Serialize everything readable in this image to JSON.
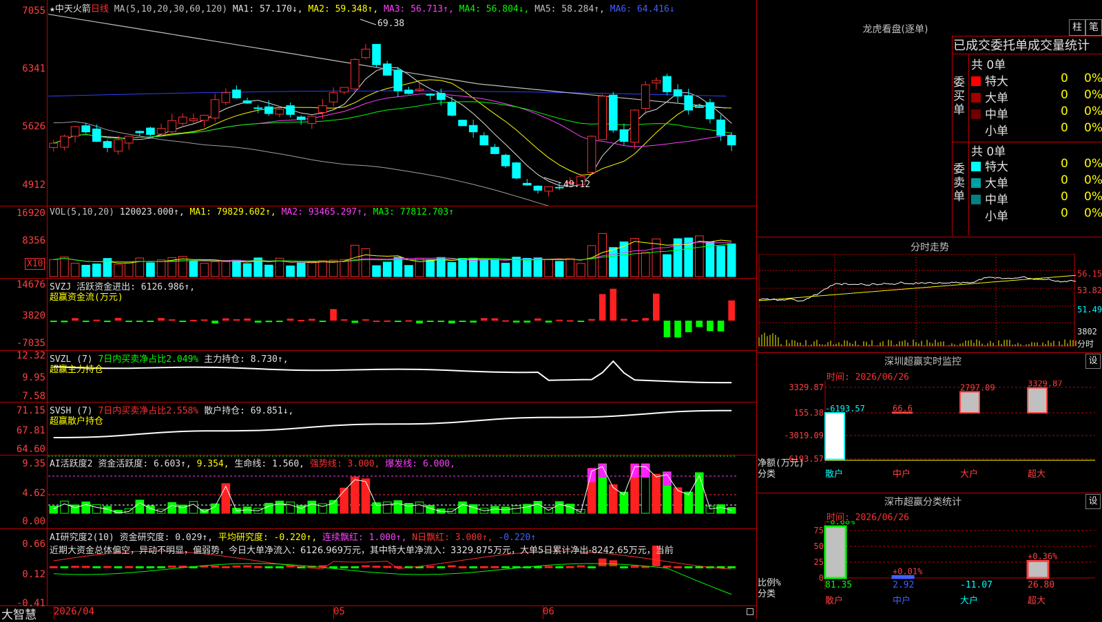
{
  "main": {
    "title": "中天火箭",
    "period": "日线",
    "ma_label": "MA(5,10,20,30,60,120)",
    "ma_values": [
      {
        "label": "MA1: 57.170↓,",
        "color": "#e0e0e0"
      },
      {
        "label": "MA2: 59.348↑,",
        "color": "#ffff00"
      },
      {
        "label": "MA3: 56.713↑,",
        "color": "#ff40ff"
      },
      {
        "label": "MA4: 56.804↓,",
        "color": "#00ff00"
      },
      {
        "label": "MA5: 58.284↑,",
        "color": "#c0c0c0"
      },
      {
        "label": "MA6: 64.416↓",
        "color": "#4060ff"
      }
    ],
    "y_ticks": [
      "7055",
      "6341",
      "5626",
      "4912"
    ],
    "high_label": "69.38",
    "low_label": "49.12"
  },
  "vol": {
    "label": "VOL(5,10,20)",
    "value": "120023.000↑,",
    "ma1": "MA1: 79829.602↑,",
    "ma2": "MA2: 93465.297↑,",
    "ma3": "MA3: 77812.703↑",
    "y_ticks": [
      "16920",
      "8356"
    ],
    "unit": "X10"
  },
  "svzj": {
    "label": "SVZJ  活跃资金进出: 6126.986↑,",
    "sub": "超赢资金流(万元)",
    "y_ticks": [
      "14676",
      "3820",
      "-7035"
    ]
  },
  "svzl": {
    "label": "SVZL (7)",
    "part2": "7日内买卖净占比2.049%",
    "part3": "主力持仓: 8.730↑,",
    "sub": "超赢主力持仓",
    "y_ticks": [
      "12.32",
      "9.95",
      "7.58"
    ]
  },
  "svsh": {
    "label": "SVSH (7)",
    "part2": "7日内买卖净占比2.558%",
    "part3": "散户持仓: 69.851↓,",
    "sub": "超赢散户持仓",
    "y_ticks": [
      "71.15",
      "67.81",
      "64.60"
    ]
  },
  "ai": {
    "label": "AI活跃度2",
    "p1": "资金活跃度: 6.603↑,",
    "p2": "9.354,",
    "p3": "生命线: 1.560,",
    "p4": "强势线: 3.000,",
    "p5": "爆发线: 6.000,",
    "y_ticks": [
      "9.35",
      "4.62",
      "0.00"
    ]
  },
  "air": {
    "label": "AI研究度2(10)",
    "p1": "资金研究度: 0.029↑,",
    "p2": "平均研究度: -0.220↑,",
    "p3": "连续飘红: 1.000↑,",
    "p4": "N日飘红: 3.000↑,",
    "p5": "-0.220↑",
    "desc": "近期大资金总体偏空，异动不明显，偏弱势，今日大单净流入：6126.969万元，其中特大单净流入：3329.875万元，大单5日累计净出-8242.65万元，当前",
    "y_ticks": [
      "0.66",
      "0.12",
      "-0.41"
    ]
  },
  "bottom": {
    "app": "大智慧",
    "date1": "2026/04",
    "date2": "05",
    "date3": "06"
  },
  "right": {
    "dragon_title": "龙虎看盘(逐单)",
    "btn1": "柱",
    "btn2": "笔",
    "stats_title": "已成交委托单成交量统计",
    "buy_total": "共 0单",
    "buy_label": "委买单",
    "sell_total": "共 0单",
    "sell_label": "委卖单",
    "buy_rows": [
      {
        "name": "特大",
        "n": "0",
        "p": "0%",
        "color": "#ff0000"
      },
      {
        "name": "大单",
        "n": "0",
        "p": "0%",
        "color": "#a00000"
      },
      {
        "name": "中单",
        "n": "0",
        "p": "0%",
        "color": "#700000"
      },
      {
        "name": "小单",
        "n": "0",
        "p": "0%",
        "color": "#000000"
      }
    ],
    "sell_rows": [
      {
        "name": "特大",
        "n": "0",
        "p": "0%",
        "color": "#00ffff"
      },
      {
        "name": "大单",
        "n": "0",
        "p": "0%",
        "color": "#00a0a0"
      },
      {
        "name": "中单",
        "n": "0",
        "p": "0%",
        "color": "#008080"
      },
      {
        "name": "小单",
        "n": "0",
        "p": "0%",
        "color": "#000000"
      }
    ],
    "fenshi_title": "分时走势",
    "fenshi_ticks": [
      "56.15",
      "53.82",
      "51.49",
      "3802",
      "分时"
    ],
    "sz_title": "深圳超赢实时监控",
    "sz_btn": "设",
    "sz_time": "时间: 2026/06/26",
    "sz_ticks": [
      "3329.87",
      "155.38",
      "-3019.09",
      "-6193.57"
    ],
    "sz_ylabel": "净额(万元)",
    "sz_xlabel": "分类",
    "sz_bars": [
      {
        "cat": "散户",
        "label": "-6193.57",
        "color": "#00ffff"
      },
      {
        "cat": "中户",
        "label": "66.6",
        "color": "#ff4040"
      },
      {
        "cat": "大户",
        "label": "2797.09",
        "color": "#ff4040"
      },
      {
        "cat": "超大",
        "label": "3329.87",
        "color": "#ff4040"
      }
    ],
    "cls_title": "深市超赢分类统计",
    "cls_btn": "设",
    "cls_time": "时间: 2026/06/26",
    "cls_ticks": [
      "75",
      "50",
      "25",
      "0"
    ],
    "cls_ylabel": "比例%",
    "cls_xlabel": "分类",
    "cls_bars": [
      {
        "cat": "散户",
        "top": "-0.68%",
        "val": "81.35",
        "color": "#00ff00"
      },
      {
        "cat": "中户",
        "top": "+0.01%",
        "val": "2.92",
        "color": "#4060ff"
      },
      {
        "cat": "大户",
        "top": "",
        "val": "-11.07",
        "color": "#00ffff"
      },
      {
        "cat": "超大",
        "top": "+0.36%",
        "val": "26.80",
        "color": "#ff4040"
      }
    ]
  }
}
